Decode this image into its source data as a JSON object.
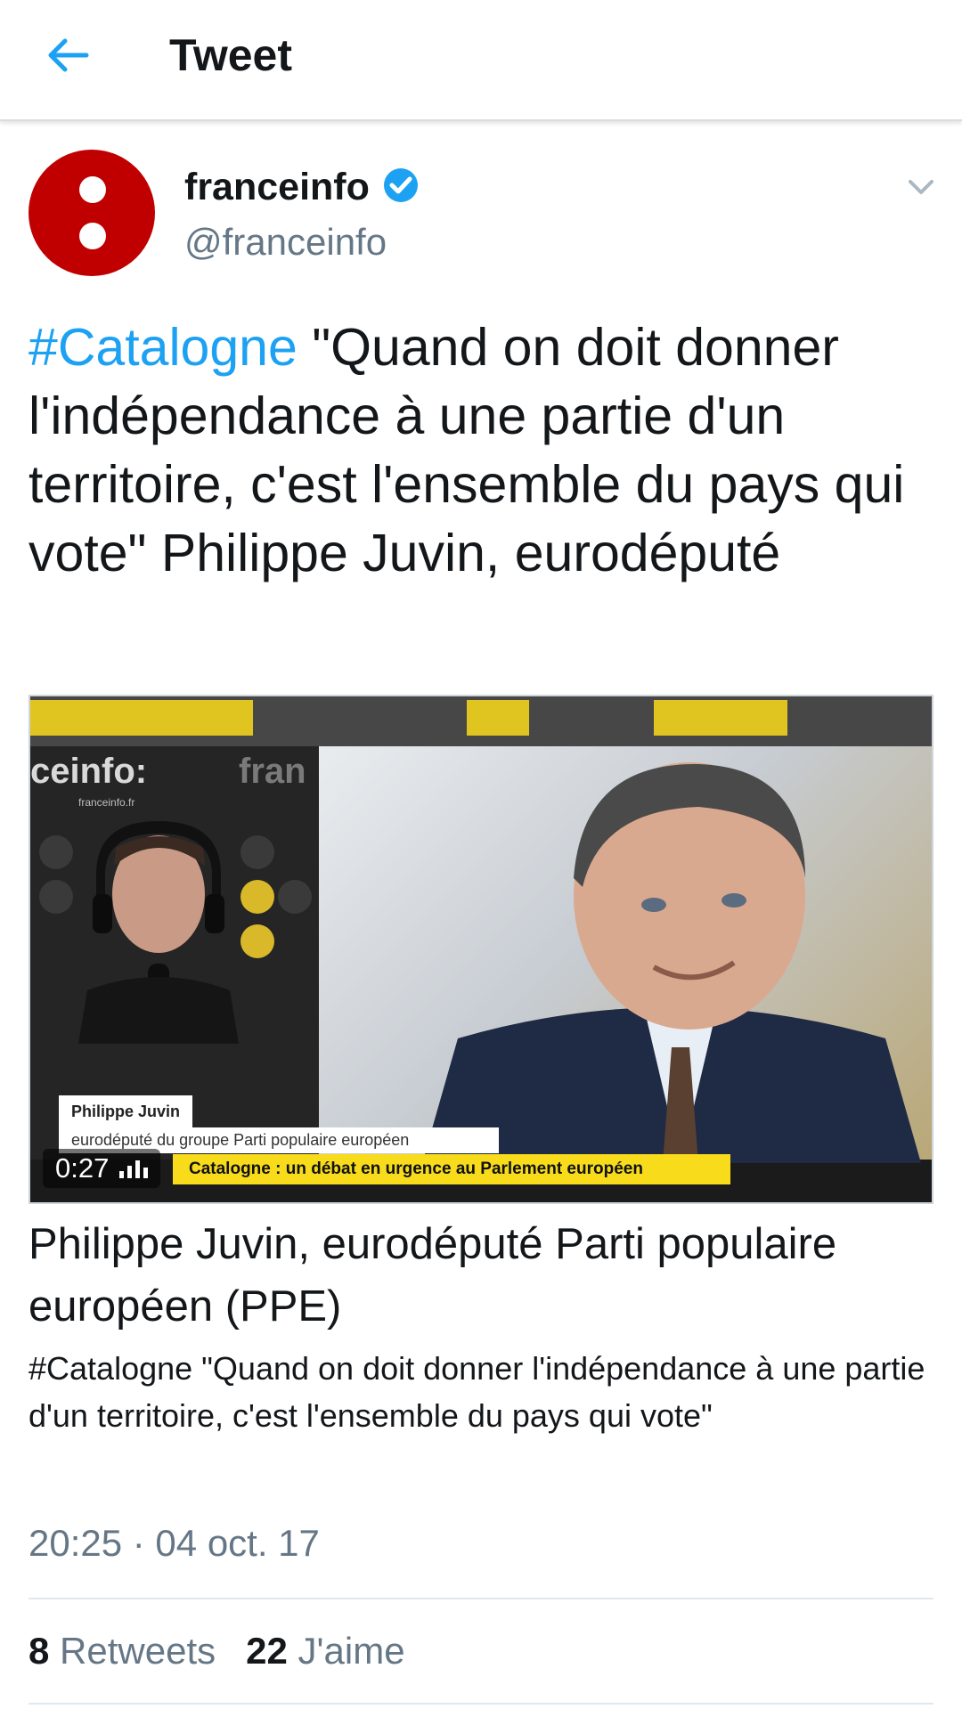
{
  "header": {
    "title": "Tweet",
    "back_icon": "arrow-left-icon",
    "accent": "#1da1f2"
  },
  "author": {
    "name": "franceinfo",
    "handle": "@franceinfo",
    "verified": true,
    "avatar_color": "#c00000"
  },
  "tweet": {
    "hashtag": "#Catalogne",
    "text": " \"Quand on doit donner l'indépendance à une partie d'un territoire, c'est l'ensemble du pays qui vote\" Philippe Juvin, eurodéputé"
  },
  "media": {
    "duration": "0:27",
    "brand_text": "ceinfo:",
    "brand_small": "franceinfo.fr",
    "brand_text_2": "fran",
    "lower_third_name": "Philippe Juvin",
    "lower_third_sub": "eurodéputé du groupe Parti populaire européen",
    "ticker": "Catalogne : un débat en urgence au Parlement européen"
  },
  "card": {
    "title": "Philippe Juvin, eurodéputé Parti populaire européen (PPE)",
    "description": "#Catalogne \"Quand on doit donner l'indépendance à une partie d'un territoire, c'est l'ensemble du pays qui vote\""
  },
  "timestamp": "20:25 · 04 oct. 17",
  "stats": {
    "retweets_count": "8",
    "retweets_label": "Retweets",
    "likes_count": "22",
    "likes_label": "J'aime"
  }
}
